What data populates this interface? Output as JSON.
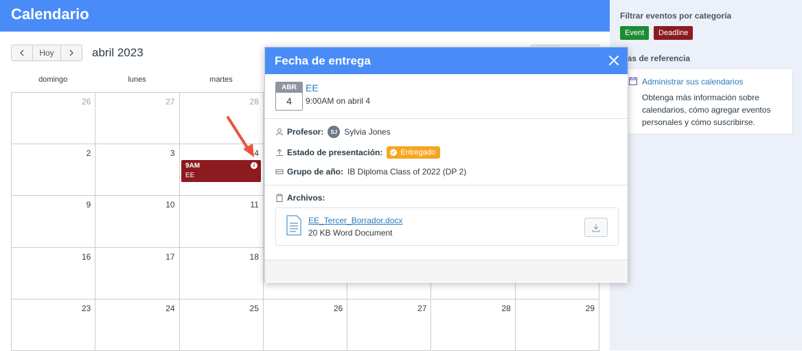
{
  "app": {
    "title": "Calendario"
  },
  "toolbar": {
    "prev_icon": "chevron-left-icon",
    "today_label": "Hoy",
    "next_icon": "chevron-right-icon",
    "month_label": "abril 2023"
  },
  "weekdays": [
    "domingo",
    "lunes",
    "martes"
  ],
  "grid": {
    "rows": [
      [
        "26",
        "27",
        "28",
        "",
        "",
        "",
        ""
      ],
      [
        "2",
        "3",
        "4",
        "",
        "",
        "",
        ""
      ],
      [
        "9",
        "10",
        "11",
        "",
        "",
        "",
        ""
      ],
      [
        "16",
        "17",
        "18",
        "",
        "",
        "",
        ""
      ],
      [
        "23",
        "24",
        "25",
        "26",
        "27",
        "28",
        "29"
      ]
    ]
  },
  "event": {
    "time": "9AM",
    "name": "EE",
    "color": "#8b1b1f"
  },
  "sidebar": {
    "filter_title": "Filtrar eventos por categoría",
    "chips": [
      {
        "label": "Event",
        "color": "#1e8c34"
      },
      {
        "label": "Deadline",
        "color": "#8b1b1f"
      }
    ],
    "ref_title": "uías de referencia",
    "ref_link": "Administrar sus calendarios",
    "ref_desc": "Obtenga más información sobre calendarios, cómo agregar eventos personales y cómo suscribirse."
  },
  "popover": {
    "title": "Fecha de entrega",
    "badge_month": "ABR",
    "badge_day": "4",
    "event_title": "EE",
    "event_when": "9:00AM on abril 4",
    "teacher_label": "Profesor:",
    "teacher_initials": "SJ",
    "teacher_name": "Sylvia Jones",
    "status_label": "Estado de presentación:",
    "status_value": "Entregado",
    "group_label": "Grupo de año:",
    "group_value": "IB Diploma Class of 2022 (DP 2)",
    "files_label": "Archivos:",
    "file_name": "EE_Tercer_Borrador.docx",
    "file_meta": "20 KB Word Document"
  },
  "colors": {
    "accent": "#4a8cf7",
    "link": "#2b7abc",
    "status": "#f5a623"
  }
}
